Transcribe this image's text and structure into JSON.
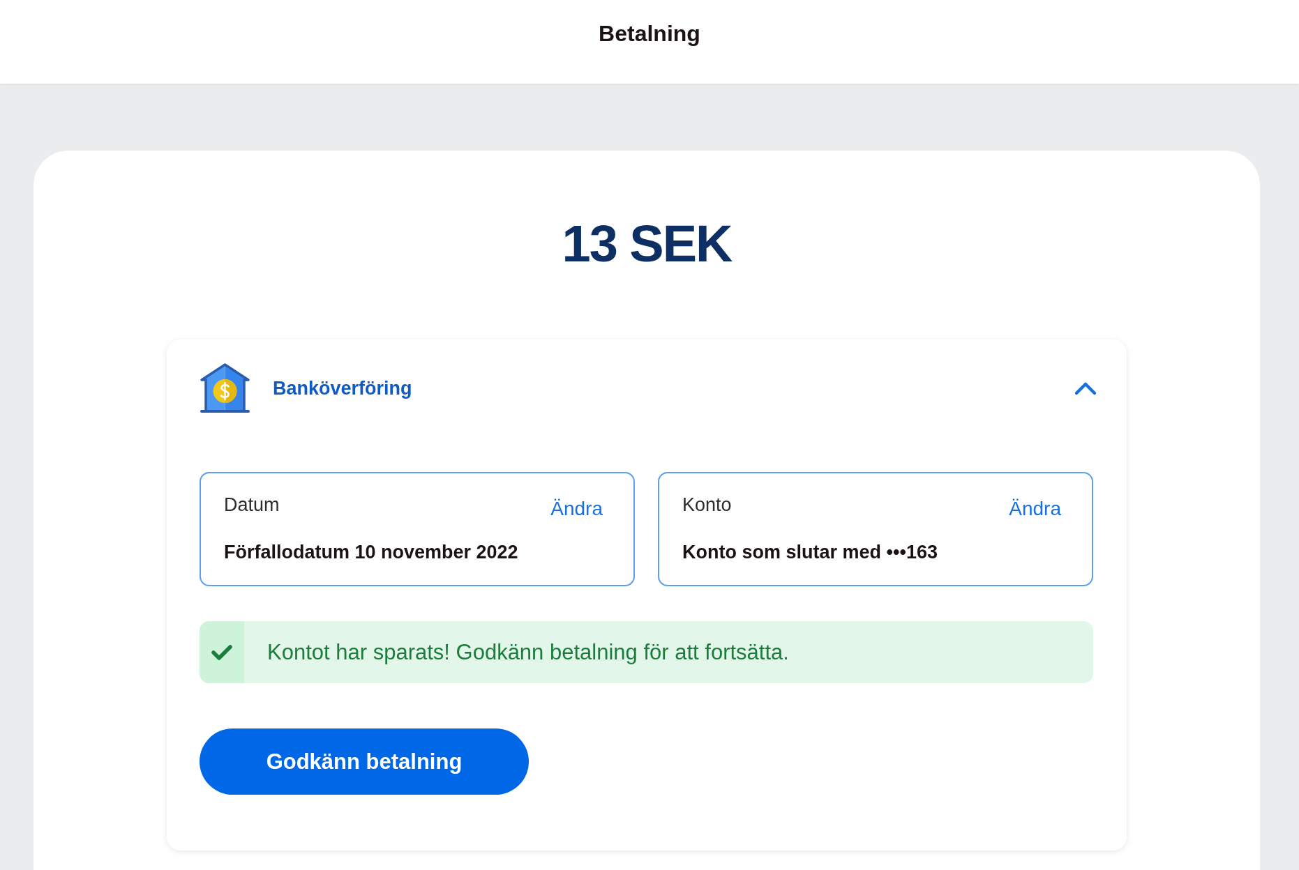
{
  "header": {
    "title": "Betalning"
  },
  "amount": "13 SEK",
  "payment_method": {
    "label": "Banköverföring",
    "expanded": true,
    "details": [
      {
        "label": "Datum",
        "action": "Ändra",
        "value": "Förfallodatum 10 november 2022"
      },
      {
        "label": "Konto",
        "action": "Ändra",
        "value": "Konto som slutar med •••163"
      }
    ],
    "notice": {
      "kind": "success",
      "text": "Kontot har sparats! Godkänn betalning för att fortsätta."
    },
    "button": "Godkänn betalning"
  }
}
